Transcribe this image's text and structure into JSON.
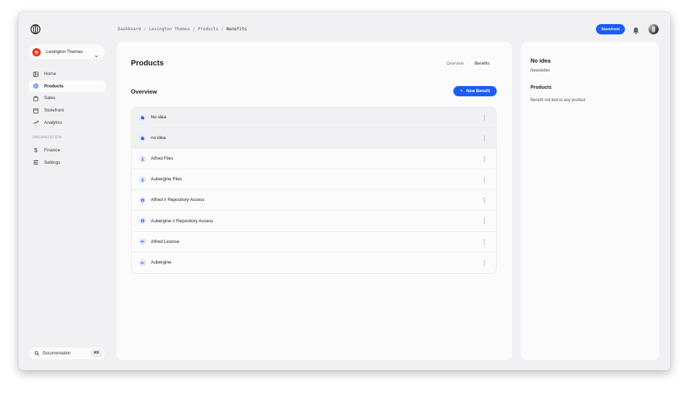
{
  "breadcrumb": [
    "Dashboard",
    "Lexington Themes",
    "Products",
    "Benefits"
  ],
  "header": {
    "storefront_label": "Storefront"
  },
  "organization": {
    "name": "Lexington Themes"
  },
  "sidebar": {
    "items": [
      {
        "label": "Home",
        "icon": "home-icon"
      },
      {
        "label": "Products",
        "icon": "cube-icon",
        "active": true
      },
      {
        "label": "Sales",
        "icon": "bag-icon"
      },
      {
        "label": "Storefront",
        "icon": "store-icon"
      },
      {
        "label": "Analytics",
        "icon": "trend-icon"
      }
    ],
    "section_label": "ORGANIZATION",
    "org_items": [
      {
        "label": "Finance",
        "icon": "dollar-icon"
      },
      {
        "label": "Settings",
        "icon": "sliders-icon"
      }
    ],
    "documentation": {
      "label": "Documentation",
      "shortcut": "⌘K"
    }
  },
  "main": {
    "title": "Products",
    "tabs": [
      {
        "label": "Overview",
        "active": false
      },
      {
        "label": "Benefits",
        "active": true
      }
    ],
    "section_title": "Overview",
    "new_button_label": "New Benefit",
    "benefits": [
      {
        "label": "No idea",
        "icon": "newsletter-icon",
        "selected": true
      },
      {
        "label": "no idea",
        "icon": "newsletter-icon",
        "selected": true
      },
      {
        "label": "Alfred Files",
        "icon": "download-icon"
      },
      {
        "label": "Aubergine Files",
        "icon": "download-icon"
      },
      {
        "label": "Alfred // Repository Access",
        "icon": "github-icon"
      },
      {
        "label": "Aubergine // Repository Access",
        "icon": "github-icon"
      },
      {
        "label": "Alfred License",
        "icon": "key-icon"
      },
      {
        "label": "Aubergine",
        "icon": "key-icon"
      }
    ]
  },
  "detail": {
    "title": "No idea",
    "type": "Newsletter",
    "products_heading": "Products",
    "products_text": "Benefit not tied to any product"
  },
  "colors": {
    "accent": "#1a5ef6",
    "background": "#f1f1f3",
    "card": "#fbfbfb"
  }
}
